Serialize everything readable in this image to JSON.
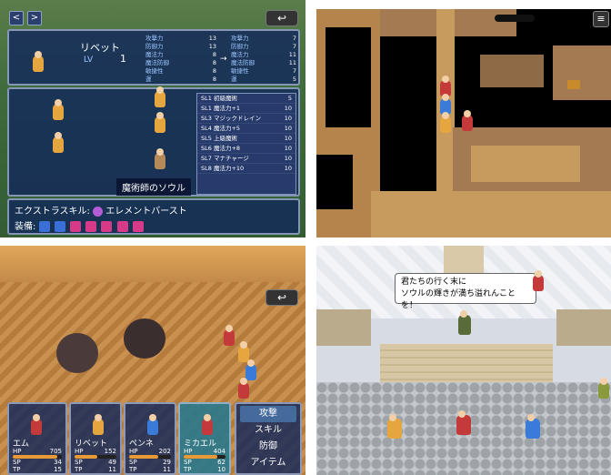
{
  "p1": {
    "prev_label": "<",
    "next_label": ">",
    "back_label": "↩",
    "actor": {
      "name": "リベット",
      "lv_label": "LV",
      "lv_value": "1"
    },
    "stats_left": [
      {
        "label": "攻撃力",
        "value": "13"
      },
      {
        "label": "防御力",
        "value": "13"
      },
      {
        "label": "魔法力",
        "value": "8"
      },
      {
        "label": "魔法防御",
        "value": "8"
      },
      {
        "label": "敏捷性",
        "value": "8"
      },
      {
        "label": "運",
        "value": "8"
      }
    ],
    "arrow": "→",
    "stats_right": [
      {
        "label": "攻撃力",
        "value": "7"
      },
      {
        "label": "防御力",
        "value": "7"
      },
      {
        "label": "魔法力",
        "value": "11"
      },
      {
        "label": "魔法防御",
        "value": "11"
      },
      {
        "label": "敏捷性",
        "value": "7"
      },
      {
        "label": "運",
        "value": "5"
      }
    ],
    "skills": [
      {
        "name": "SL1 初級魔術",
        "cost": "5"
      },
      {
        "name": "SL1 魔法力+1",
        "cost": "10"
      },
      {
        "name": "SL3 マジックドレイン",
        "cost": "10"
      },
      {
        "name": "SL4 魔法力+5",
        "cost": "10"
      },
      {
        "name": "SL5 上級魔術",
        "cost": "10"
      },
      {
        "name": "SL6 魔法力+8",
        "cost": "10"
      },
      {
        "name": "SL7 マナチャージ",
        "cost": "10"
      },
      {
        "name": "SL8 魔法力+10",
        "cost": "10"
      }
    ],
    "soul_label": "魔術師のソウル",
    "ex_skill_label": "エクストラスキル:",
    "ex_skill_value": "エレメントバースト",
    "equip_label": "装備:"
  },
  "p3": {
    "back_label": "↩",
    "party": [
      {
        "name": "エム",
        "hp": "705",
        "sp": "34",
        "tp": "15",
        "hp_frac": 0.9,
        "sp_frac": 0.5,
        "tp_frac": 0.15
      },
      {
        "name": "リベット",
        "hp": "152",
        "sp": "49",
        "tp": "11",
        "hp_frac": 0.55,
        "sp_frac": 0.7,
        "tp_frac": 0.11
      },
      {
        "name": "ペンネ",
        "hp": "202",
        "sp": "29",
        "tp": "11",
        "hp_frac": 0.7,
        "sp_frac": 0.45,
        "tp_frac": 0.11
      },
      {
        "name": "ミカエル",
        "hp": "404",
        "sp": "62",
        "tp": "10",
        "hp_frac": 0.8,
        "sp_frac": 0.85,
        "tp_frac": 0.1
      }
    ],
    "hp_label": "HP",
    "sp_label": "SP",
    "tp_label": "TP",
    "commands": [
      "攻撃",
      "スキル",
      "防御",
      "アイテム"
    ]
  },
  "p4": {
    "dialog_line1": "君たちの行く末に",
    "dialog_line2": "ソウルの輝きが満ち溢れんことを！"
  }
}
